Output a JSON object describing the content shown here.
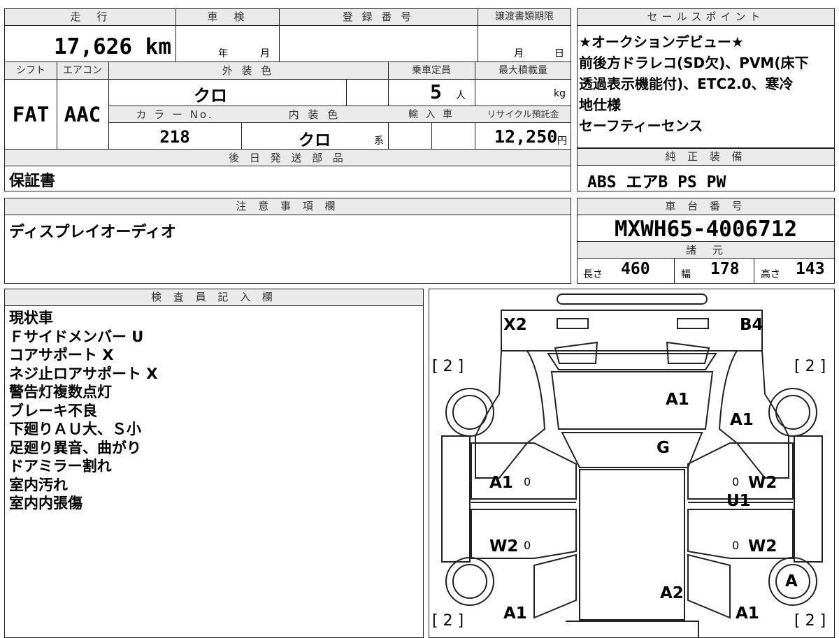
{
  "mileage": {
    "header": "走　行",
    "value": "17,626",
    "unit": "km"
  },
  "inspection": {
    "header": "車　検",
    "year_label": "年",
    "month_label": "月"
  },
  "registration": {
    "header": "登 録 番 号"
  },
  "transfer_deadline": {
    "header": "譲渡書類期限",
    "month_label": "月",
    "day_label": "日"
  },
  "shift": {
    "header": "シフト",
    "value": "FAT"
  },
  "aircon": {
    "header": "エアコン",
    "value": "AAC"
  },
  "exterior_color": {
    "header": "外 装 色",
    "value": "クロ"
  },
  "capacity": {
    "header": "乗車定員",
    "value": "5",
    "unit": "人"
  },
  "max_load": {
    "header": "最大積載量",
    "unit": "kg"
  },
  "color_no": {
    "header": "カ ラ ー No.",
    "value": "218"
  },
  "interior_color": {
    "header": "内 装 色",
    "value": "クロ",
    "suffix": "系"
  },
  "import": {
    "header": "輸 入 車"
  },
  "recycle": {
    "header": "リサイクル預託金",
    "value": "12,250",
    "unit": "円"
  },
  "later_parts": {
    "header": "後 日 発 送 部 品",
    "value": "保証書"
  },
  "sales_points": {
    "header": "セールスポイント",
    "lines": [
      "★オークションデビュー★",
      "前後方ドラレコ(SD欠)、PVM(床下",
      "透過表示機能付)、ETC2.0、寒冷",
      "地仕様",
      "セーフティーセンス"
    ]
  },
  "standard_equipment": {
    "header": "純 正 装 備",
    "value": "ABS エアB PS PW"
  },
  "notes": {
    "header": "注 意 事 項 欄",
    "value": "ディスプレイオーディオ"
  },
  "chassis": {
    "header": "車 台 番 号",
    "value": "MXWH65-4006712"
  },
  "specs": {
    "header": "諸　元",
    "length_label": "長さ",
    "length": "460",
    "width_label": "幅",
    "width": "178",
    "height_label": "高さ",
    "height": "143"
  },
  "inspector": {
    "header": "検 査 員 記 入 欄",
    "lines": [
      "現状車",
      "Ｆサイドメンバー U",
      "コアサポート X",
      "ネジ止ロアサポート X",
      "警告灯複数点灯",
      "ブレーキ不良",
      "下廻りＡＵ大、Ｓ小",
      "足廻り異音、曲がり",
      "ドアミラー割れ",
      "室内汚れ",
      "室内内張傷"
    ]
  },
  "diagram": {
    "marks": {
      "front_left": "X2",
      "front_right": "B4",
      "hood": "A1",
      "front_right_fender": "A1",
      "windshield": "G",
      "front_left_door": "A1",
      "front_right_door": "W2",
      "rocker": "U1",
      "rear_left_door": "W2",
      "rear_right_door": "W2",
      "rear_right_wheel": "A",
      "roof_rear": "A2",
      "rear_left_fender": "A1",
      "rear_right_fender": "A1"
    },
    "bracket_tl": "[ 2 ]",
    "bracket_tr": "[ 2 ]",
    "bracket_bl": "[ 2 ]",
    "bracket_br": "[ 2 ]",
    "zero": "0"
  }
}
